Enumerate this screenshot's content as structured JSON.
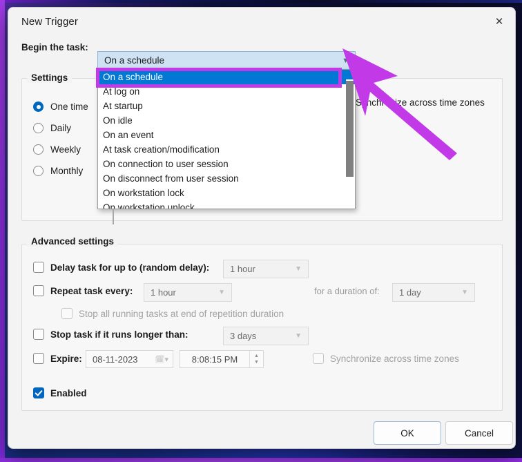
{
  "window": {
    "title": "New Trigger",
    "close_icon": "close-icon"
  },
  "begin": {
    "label": "Begin the task:",
    "selected": "On a schedule",
    "chevron_icon": "chevron-down-icon"
  },
  "dropdown": {
    "items": [
      "On a schedule",
      "At log on",
      "At startup",
      "On idle",
      "On an event",
      "At task creation/modification",
      "On connection to user session",
      "On disconnect from user session",
      "On workstation lock",
      "On workstation unlock"
    ],
    "selected_index": 0,
    "highlight_color": "#c23ae8"
  },
  "settings": {
    "title": "Settings",
    "options": [
      {
        "label": "One time",
        "checked": true
      },
      {
        "label": "Daily",
        "checked": false
      },
      {
        "label": "Weekly",
        "checked": false
      },
      {
        "label": "Monthly",
        "checked": false
      }
    ],
    "sync_label": "Synchronize across time zones"
  },
  "advanced": {
    "title": "Advanced settings",
    "delay": {
      "label": "Delay task for up to (random delay):",
      "checked": false,
      "value": "1 hour"
    },
    "repeat": {
      "label": "Repeat task every:",
      "checked": false,
      "value": "1 hour",
      "duration_label": "for a duration of:",
      "duration_value": "1 day"
    },
    "stop_all": {
      "label": "Stop all running tasks at end of repetition duration",
      "checked": false
    },
    "stop_task": {
      "label": "Stop task if it runs longer than:",
      "checked": false,
      "value": "3 days"
    },
    "expire": {
      "label": "Expire:",
      "checked": false,
      "date": "08-11-2023",
      "time": "8:08:15 PM",
      "calendar_icon": "calendar-icon",
      "sync_label": "Synchronize across time zones",
      "sync_checked": false
    },
    "enabled": {
      "label": "Enabled",
      "checked": true
    }
  },
  "footer": {
    "ok_label": "OK",
    "cancel_label": "Cancel"
  },
  "annotation": {
    "arrow_color": "#c23ae8",
    "arrow_name": "pointer-arrow-annotation"
  }
}
